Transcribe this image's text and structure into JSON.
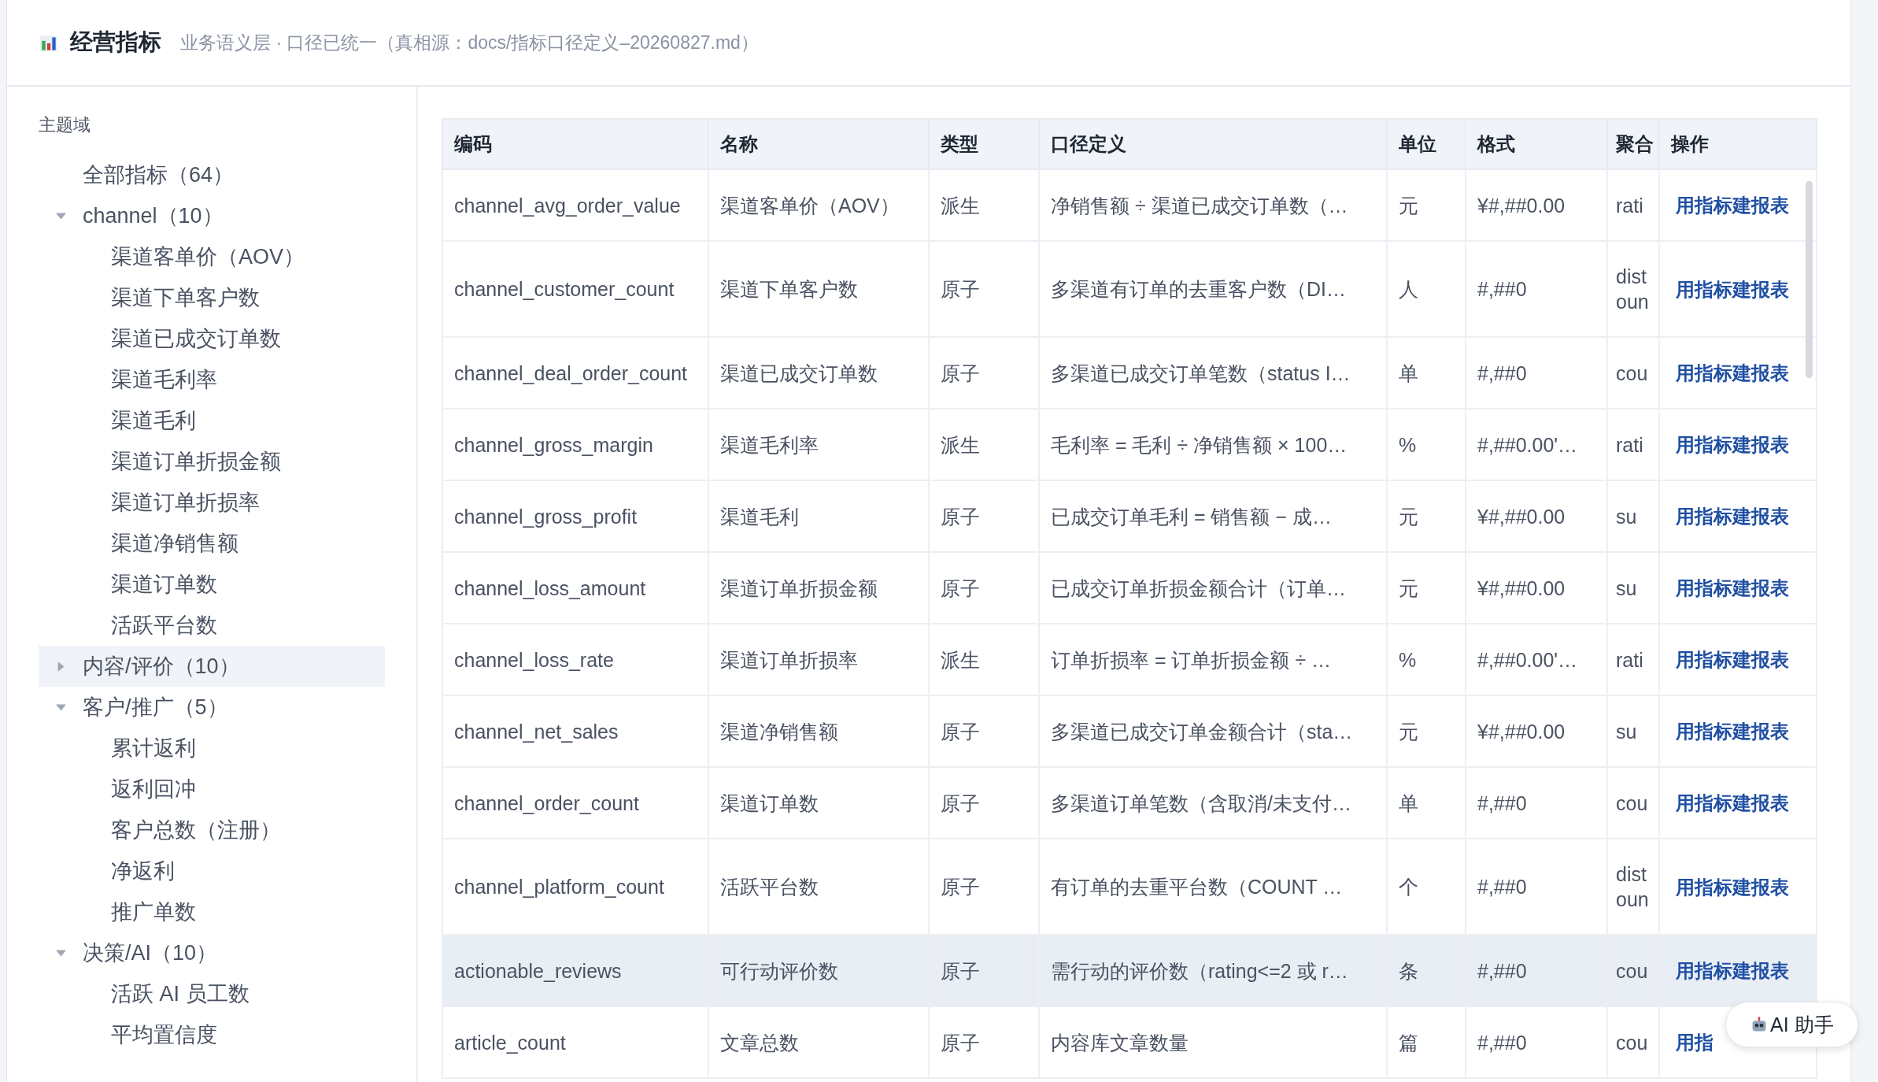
{
  "header": {
    "title": "经营指标",
    "subtitle": "业务语义层 · 口径已统一（真相源：docs/指标口径定义–20260827.md）"
  },
  "sidebar": {
    "heading": "主题域",
    "items": [
      {
        "label": "全部指标（64）",
        "selected": false
      },
      {
        "label": "channel（10）",
        "selected": false,
        "expanded": true,
        "children": [
          {
            "label": "渠道客单价（AOV）",
            "selected": false
          },
          {
            "label": "渠道下单客户数",
            "selected": false
          },
          {
            "label": "渠道已成交订单数",
            "selected": false
          },
          {
            "label": "渠道毛利率",
            "selected": false
          },
          {
            "label": "渠道毛利",
            "selected": false
          },
          {
            "label": "渠道订单折损金额",
            "selected": false
          },
          {
            "label": "渠道订单折损率",
            "selected": false
          },
          {
            "label": "渠道净销售额",
            "selected": false
          },
          {
            "label": "渠道订单数",
            "selected": false
          },
          {
            "label": "活跃平台数",
            "selected": false
          }
        ]
      },
      {
        "label": "内容/评价（10）",
        "selected": true,
        "expanded": false
      },
      {
        "label": "客户/推广（5）",
        "selected": false,
        "expanded": true,
        "children": [
          {
            "label": "累计返利",
            "selected": false
          },
          {
            "label": "返利回冲",
            "selected": false
          },
          {
            "label": "客户总数（注册）",
            "selected": false
          },
          {
            "label": "净返利",
            "selected": false
          },
          {
            "label": "推广单数",
            "selected": false
          }
        ]
      },
      {
        "label": "决策/AI（10）",
        "selected": false,
        "expanded": true,
        "children": [
          {
            "label": "活跃 AI 员工数",
            "selected": false
          },
          {
            "label": "平均置信度",
            "selected": false
          }
        ]
      }
    ]
  },
  "table": {
    "columns": [
      "编码",
      "名称",
      "类型",
      "口径定义",
      "单位",
      "格式",
      "聚合",
      "操作"
    ],
    "rows": [
      {
        "code": "channel_avg_order_value",
        "name": "渠道客单价（AOV）",
        "type": "派生",
        "definition": "净销售额 ÷ 渠道已成交订单数（…",
        "unit": "元",
        "format": "¥#,##0.00",
        "aggregation": "rati",
        "action": "用指标建报表",
        "selected": false
      },
      {
        "code": "channel_customer_count",
        "name": "渠道下单客户数",
        "type": "原子",
        "definition": "多渠道有订单的去重客户数（DI…",
        "unit": "人",
        "format": "#,##0",
        "aggregation": "dist oun",
        "action": "用指标建报表",
        "selected": false
      },
      {
        "code": "channel_deal_order_count",
        "name": "渠道已成交订单数",
        "type": "原子",
        "definition": "多渠道已成交订单笔数（status I…",
        "unit": "单",
        "format": "#,##0",
        "aggregation": "cou",
        "action": "用指标建报表",
        "selected": false
      },
      {
        "code": "channel_gross_margin",
        "name": "渠道毛利率",
        "type": "派生",
        "definition": "毛利率 = 毛利 ÷ 净销售额 × 100…",
        "unit": "%",
        "format": "#,##0.00'…",
        "aggregation": "rati",
        "action": "用指标建报表",
        "selected": false
      },
      {
        "code": "channel_gross_profit",
        "name": "渠道毛利",
        "type": "原子",
        "definition": "已成交订单毛利 = 销售额 − 成…",
        "unit": "元",
        "format": "¥#,##0.00",
        "aggregation": "su",
        "action": "用指标建报表",
        "selected": false
      },
      {
        "code": "channel_loss_amount",
        "name": "渠道订单折损金额",
        "type": "原子",
        "definition": "已成交订单折损金额合计（订单…",
        "unit": "元",
        "format": "¥#,##0.00",
        "aggregation": "su",
        "action": "用指标建报表",
        "selected": false
      },
      {
        "code": "channel_loss_rate",
        "name": "渠道订单折损率",
        "type": "派生",
        "definition": "订单折损率 = 订单折损金额 ÷ …",
        "unit": "%",
        "format": "#,##0.00'…",
        "aggregation": "rati",
        "action": "用指标建报表",
        "selected": false
      },
      {
        "code": "channel_net_sales",
        "name": "渠道净销售额",
        "type": "原子",
        "definition": "多渠道已成交订单金额合计（sta…",
        "unit": "元",
        "format": "¥#,##0.00",
        "aggregation": "su",
        "action": "用指标建报表",
        "selected": false
      },
      {
        "code": "channel_order_count",
        "name": "渠道订单数",
        "type": "原子",
        "definition": "多渠道订单笔数（含取消/未支付…",
        "unit": "单",
        "format": "#,##0",
        "aggregation": "cou",
        "action": "用指标建报表",
        "selected": false
      },
      {
        "code": "channel_platform_count",
        "name": "活跃平台数",
        "type": "原子",
        "definition": "有订单的去重平台数（COUNT …",
        "unit": "个",
        "format": "#,##0",
        "aggregation": "dist oun",
        "action": "用指标建报表",
        "selected": false
      },
      {
        "code": "actionable_reviews",
        "name": "可行动评价数",
        "type": "原子",
        "definition": "需行动的评价数（rating<=2 或 r…",
        "unit": "条",
        "format": "#,##0",
        "aggregation": "cou",
        "action": "用指标建报表",
        "selected": true
      },
      {
        "code": "article_count",
        "name": "文章总数",
        "type": "原子",
        "definition": "内容库文章数量",
        "unit": "篇",
        "format": "#,##0",
        "aggregation": "cou",
        "action": "用指",
        "selected": false
      }
    ]
  },
  "assistant_button": {
    "label": "AI 助手"
  }
}
